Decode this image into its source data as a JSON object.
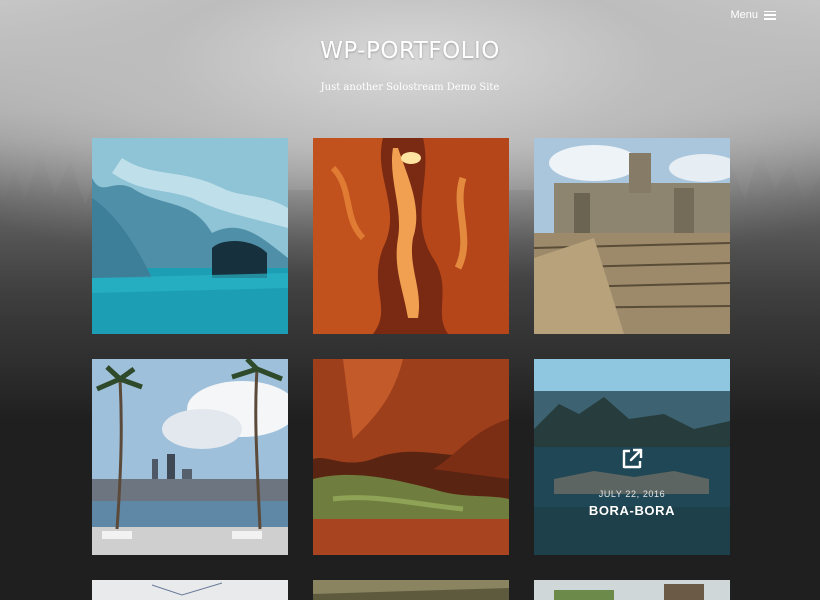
{
  "header": {
    "menu_label": "Menu",
    "site_title": "WP-PORTFOLIO",
    "tagline": "Just another Solostream Demo Site"
  },
  "portfolio": {
    "items": [
      {
        "image": "marble-caves"
      },
      {
        "image": "antelope-canyon"
      },
      {
        "image": "angkor-temple"
      },
      {
        "image": "singapore-infinity-pool"
      },
      {
        "image": "red-rock-canyon"
      },
      {
        "image": "bora-bora",
        "hover_date": "JULY 22, 2016",
        "hover_title": "BORA-BORA",
        "hover_icon": "external-link-icon"
      },
      {
        "image": "partial-sketch"
      },
      {
        "image": "partial-rock"
      },
      {
        "image": "partial-statue"
      }
    ]
  }
}
